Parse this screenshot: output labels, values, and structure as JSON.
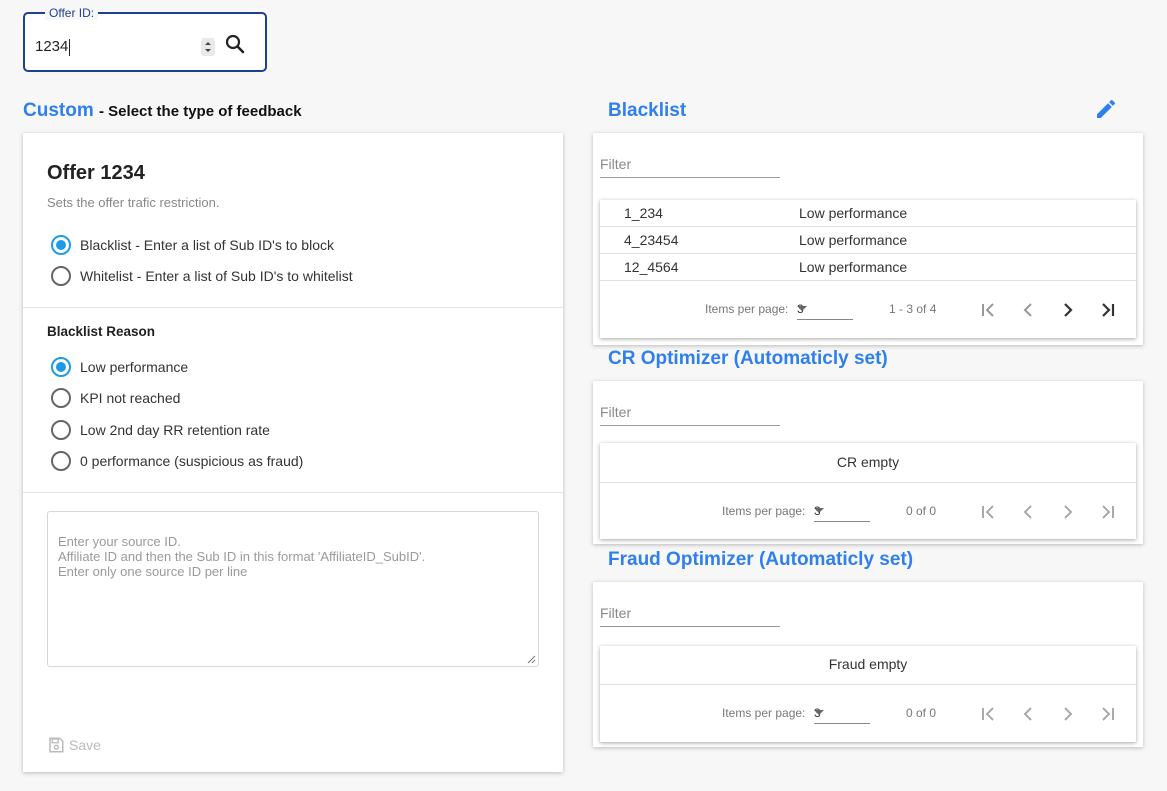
{
  "offer_field": {
    "label": "Offer ID:",
    "value": "1234"
  },
  "custom": {
    "title": "Custom",
    "subtitle": "- Select the type of feedback"
  },
  "offer_card": {
    "title": "Offer 1234",
    "subtitle": "Sets the offer trafic restriction.",
    "list_types": [
      {
        "label": "Blacklist - Enter a list of Sub ID's to block",
        "selected": true
      },
      {
        "label": "Whitelist - Enter a list of Sub ID's to whitelist",
        "selected": false
      }
    ],
    "reason_label": "Blacklist Reason",
    "reasons": [
      {
        "label": "Low performance",
        "selected": true
      },
      {
        "label": "KPI not reached",
        "selected": false
      },
      {
        "label": "Low 2nd day RR retention rate",
        "selected": false
      },
      {
        "label": "0 performance (suspicious as fraud)",
        "selected": false
      }
    ],
    "textarea_placeholder_lines": [
      "Enter your source ID.",
      "Affiliate ID and then the Sub ID in this format 'AffiliateID_SubID'.",
      "Enter only one source ID per line"
    ],
    "save_label": "Save"
  },
  "blacklist": {
    "title": "Blacklist",
    "filter_placeholder": "Filter",
    "rows": [
      {
        "id": "1_234",
        "reason": "Low performance"
      },
      {
        "id": "4_23454",
        "reason": "Low performance"
      },
      {
        "id": "12_4564",
        "reason": "Low performance"
      }
    ],
    "pager": {
      "items_per_page_label": "Items per page:",
      "page_size": "3",
      "range": "1 - 3 of 4"
    }
  },
  "cr_optimizer": {
    "title": "CR Optimizer (Automaticly set)",
    "filter_placeholder": "Filter",
    "empty_text": "CR empty",
    "pager": {
      "items_per_page_label": "Items per page:",
      "page_size": "3",
      "range": "0 of 0"
    }
  },
  "fraud_optimizer": {
    "title": "Fraud Optimizer (Automaticly set)",
    "filter_placeholder": "Filter",
    "empty_text": "Fraud empty",
    "pager": {
      "items_per_page_label": "Items per page:",
      "page_size": "3",
      "range": "0 of 0"
    }
  },
  "colors": {
    "accent": "#2f80ed",
    "radio": "#1e9be6",
    "field_border": "#1f3f8f"
  }
}
